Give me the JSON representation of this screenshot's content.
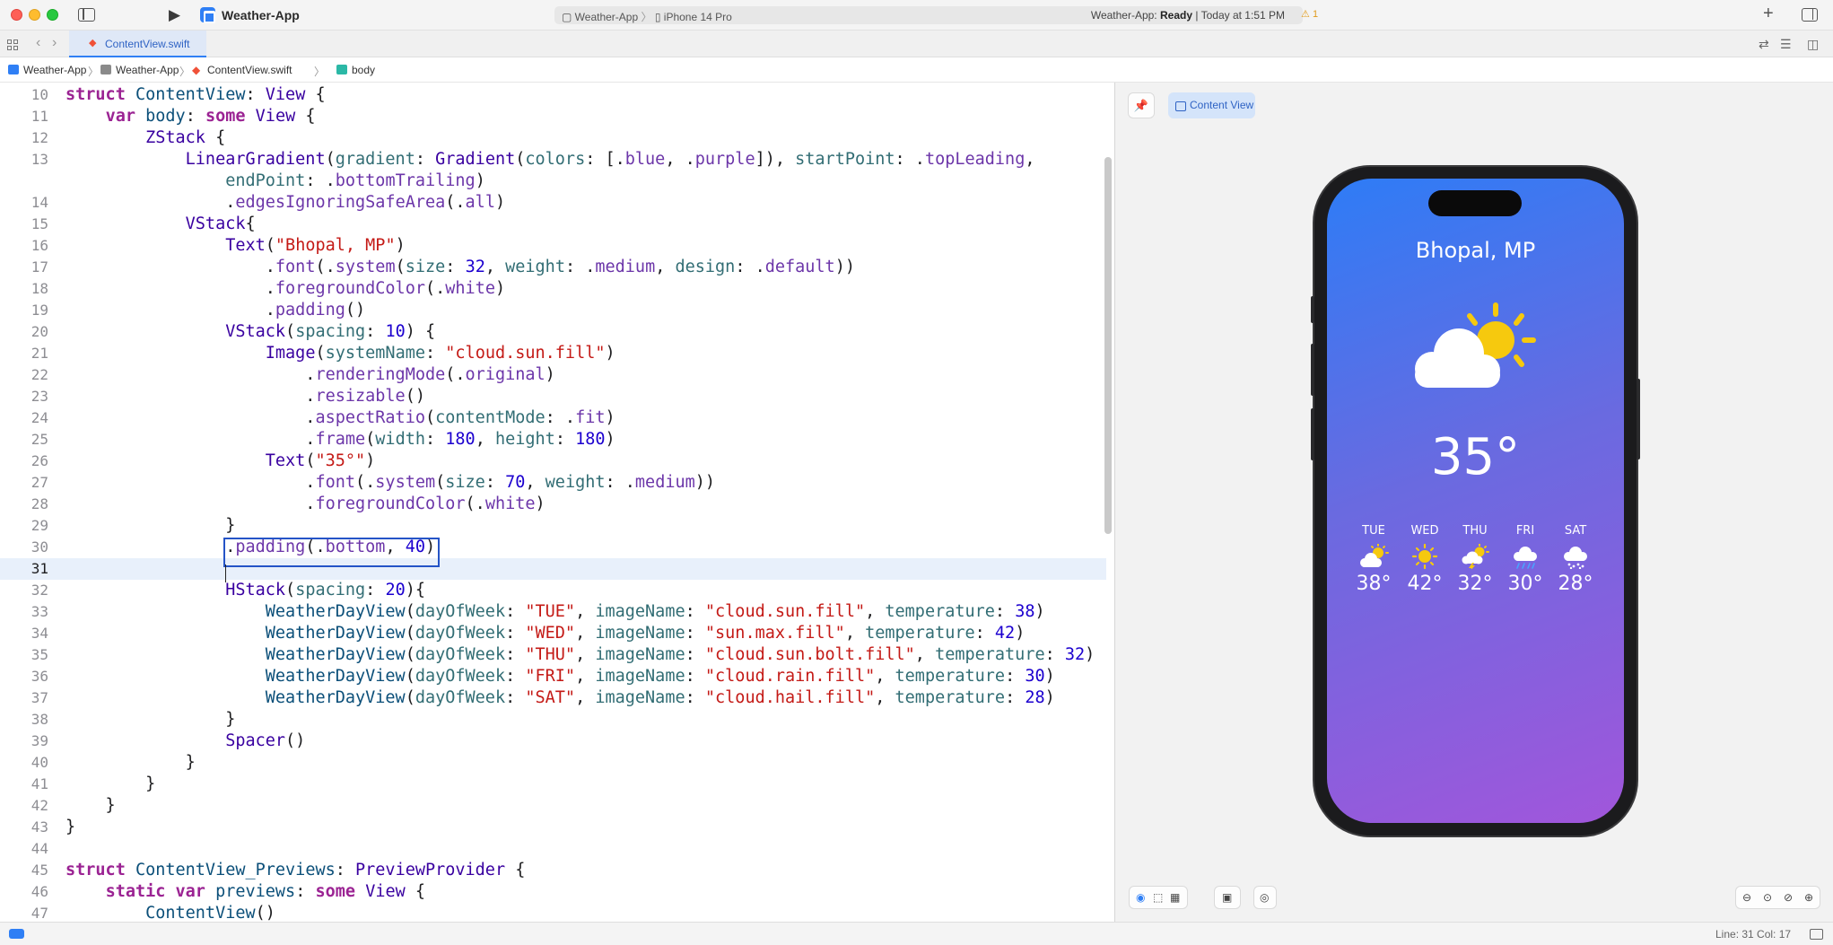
{
  "window": {
    "app_title": "Weather-App",
    "scheme": "Weather-App",
    "device": "iPhone 14 Pro",
    "status_prefix": "Weather-App:",
    "status_state": "Ready",
    "status_time": "| Today at 1:51 PM",
    "warning_count": "1"
  },
  "tabs": [
    {
      "label": "ContentView.swift",
      "active": true
    }
  ],
  "jumpbar": [
    "Weather-App",
    "Weather-App",
    "ContentView.swift",
    "body"
  ],
  "editor": {
    "current_line": 31,
    "lines": [
      {
        "n": "10"
      },
      {
        "n": "11"
      },
      {
        "n": "12"
      },
      {
        "n": "13"
      },
      {
        "n": ""
      },
      {
        "n": "14"
      },
      {
        "n": "15"
      },
      {
        "n": "16"
      },
      {
        "n": "17"
      },
      {
        "n": "18"
      },
      {
        "n": "19"
      },
      {
        "n": "20"
      },
      {
        "n": "21"
      },
      {
        "n": "22"
      },
      {
        "n": "23"
      },
      {
        "n": "24"
      },
      {
        "n": "25"
      },
      {
        "n": "26"
      },
      {
        "n": "27"
      },
      {
        "n": "28"
      },
      {
        "n": "29"
      },
      {
        "n": "30"
      },
      {
        "n": "31"
      },
      {
        "n": "32"
      },
      {
        "n": "33"
      },
      {
        "n": "34"
      },
      {
        "n": "35"
      },
      {
        "n": "36"
      },
      {
        "n": "37"
      },
      {
        "n": "38"
      },
      {
        "n": "39"
      },
      {
        "n": "40"
      },
      {
        "n": "41"
      },
      {
        "n": "42"
      },
      {
        "n": "43"
      },
      {
        "n": "44"
      },
      {
        "n": "45"
      },
      {
        "n": "46"
      },
      {
        "n": "47"
      }
    ]
  },
  "preview": {
    "chip_label": "Content View",
    "city": "Bhopal, MP",
    "main_icon": "cloud-sun-fill-icon",
    "temperature": "35°",
    "days": [
      {
        "name": "TUE",
        "icon": "cloud-sun-fill-icon",
        "temp": "38°"
      },
      {
        "name": "WED",
        "icon": "sun-max-fill-icon",
        "temp": "42°"
      },
      {
        "name": "THU",
        "icon": "cloud-sun-bolt-fill-icon",
        "temp": "32°"
      },
      {
        "name": "FRI",
        "icon": "cloud-rain-fill-icon",
        "temp": "30°"
      },
      {
        "name": "SAT",
        "icon": "cloud-hail-fill-icon",
        "temp": "28°"
      }
    ],
    "gradient_colors": [
      "#2e7cf6",
      "#a156db"
    ]
  },
  "statusbar": {
    "line_col": "Line: 31  Col: 17"
  }
}
